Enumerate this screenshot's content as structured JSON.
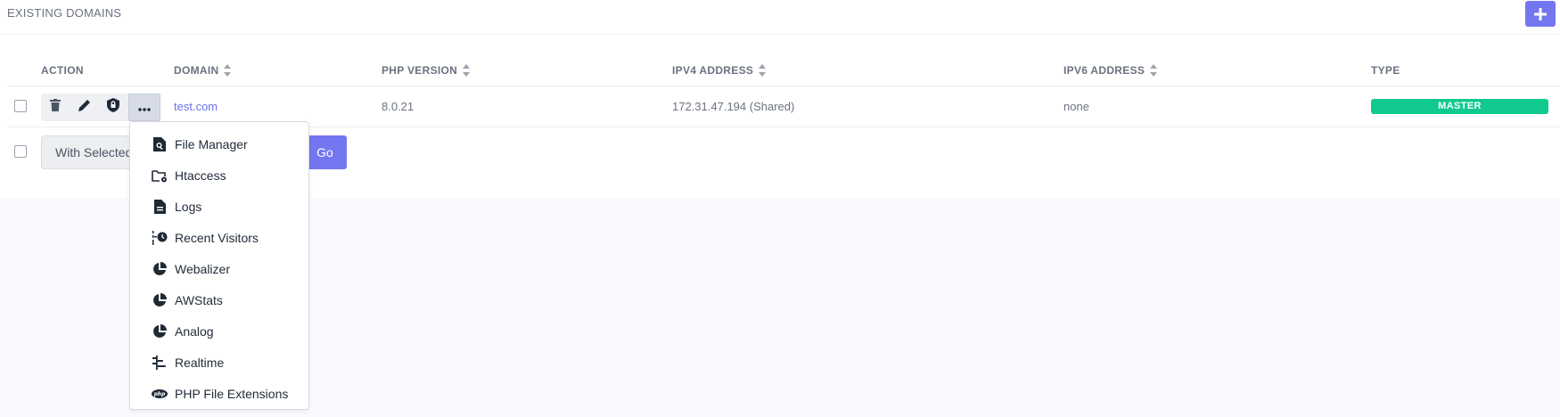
{
  "section": {
    "title": "EXISTING DOMAINS",
    "add_icon": "plus-icon"
  },
  "table": {
    "columns": [
      {
        "label": "ACTION",
        "sortable": false
      },
      {
        "label": "DOMAIN",
        "sortable": true
      },
      {
        "label": "PHP VERSION",
        "sortable": true
      },
      {
        "label": "IPV4 ADDRESS",
        "sortable": true
      },
      {
        "label": "IPV6 ADDRESS",
        "sortable": true
      },
      {
        "label": "TYPE",
        "sortable": false
      }
    ],
    "rows": [
      {
        "domain": "test.com",
        "php_version": "8.0.21",
        "ipv4": "172.31.47.194 (Shared)",
        "ipv6": "none",
        "type": "MASTER",
        "actions": [
          "trash-icon",
          "pencil-icon",
          "shield-lock-icon",
          "ellipsis-icon"
        ]
      }
    ]
  },
  "bulk": {
    "select_label": "With Selected",
    "go_label": "Go"
  },
  "menu": {
    "items": [
      {
        "label": "File Manager",
        "icon": "file-search-icon"
      },
      {
        "label": "Htaccess",
        "icon": "folder-gear-icon"
      },
      {
        "label": "Logs",
        "icon": "document-icon"
      },
      {
        "label": "Recent Visitors",
        "icon": "timeline-clock-icon"
      },
      {
        "label": "Webalizer",
        "icon": "pie-chart-icon"
      },
      {
        "label": "AWStats",
        "icon": "pie-chart-icon"
      },
      {
        "label": "Analog",
        "icon": "pie-chart-icon"
      },
      {
        "label": "Realtime",
        "icon": "realtime-bars-icon"
      },
      {
        "label": "PHP File Extensions",
        "icon": "php-icon"
      }
    ]
  },
  "colors": {
    "accent": "#7476f0",
    "link": "#6c72e8",
    "badge_master": "#10c98f"
  }
}
